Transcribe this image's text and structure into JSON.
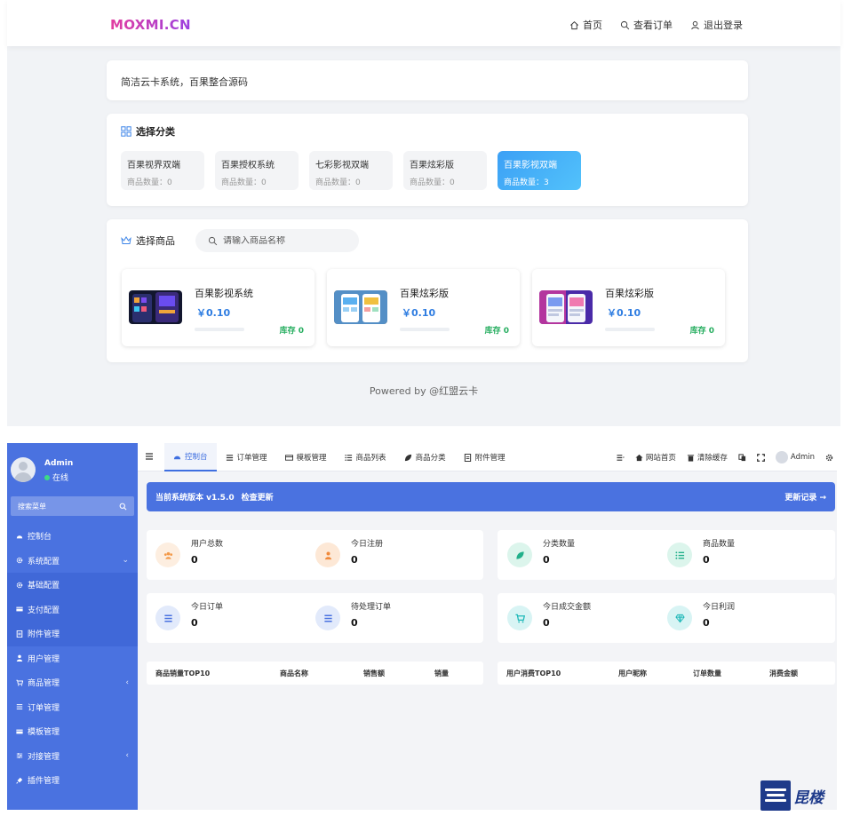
{
  "shop": {
    "logo": "MOXMI.CN",
    "nav": [
      {
        "label": "首页",
        "icon": "home-icon"
      },
      {
        "label": "查看订单",
        "icon": "search-icon"
      },
      {
        "label": "退出登录",
        "icon": "user-icon"
      }
    ],
    "notice": "简洁云卡系统，百果整合源码",
    "categories_title": "选择分类",
    "categories": [
      {
        "name": "百果视界双端",
        "count": "商品数量：0"
      },
      {
        "name": "百果授权系统",
        "count": "商品数量：0"
      },
      {
        "name": "七彩影视双端",
        "count": "商品数量：0"
      },
      {
        "name": "百果炫彩版",
        "count": "商品数量：0"
      },
      {
        "name": "百果影视双端",
        "count": "商品数量：3",
        "active": true
      }
    ],
    "goods_title": "选择商品",
    "search_placeholder": "请输入商品名称",
    "goods": [
      {
        "name": "百果影视系统",
        "price": "￥0.10",
        "stock": "库存 0"
      },
      {
        "name": "百果炫彩版",
        "price": "￥0.10",
        "stock": "库存 0"
      },
      {
        "name": "百果炫彩版",
        "price": "￥0.10",
        "stock": "库存 0"
      }
    ],
    "powered": "Powered by @红盟云卡"
  },
  "admin": {
    "user": {
      "name": "Admin",
      "status": "在线"
    },
    "search_label": "搜索菜单",
    "menu": [
      {
        "label": "控制台",
        "icon": "dashboard-icon"
      },
      {
        "label": "系统配置",
        "icon": "gear-icon",
        "arrow": "⌄"
      },
      {
        "label": "基础配置",
        "icon": "gear-icon",
        "sub": true
      },
      {
        "label": "支付配置",
        "icon": "card-icon",
        "sub": true
      },
      {
        "label": "附件管理",
        "icon": "file-icon",
        "sub": true
      },
      {
        "label": "用户管理",
        "icon": "user-icon"
      },
      {
        "label": "商品管理",
        "icon": "cart-icon",
        "arrow": "‹"
      },
      {
        "label": "订单管理",
        "icon": "list-icon"
      },
      {
        "label": "模板管理",
        "icon": "card-icon"
      },
      {
        "label": "对接管理",
        "icon": "sliders-icon",
        "arrow": "‹"
      },
      {
        "label": "插件管理",
        "icon": "plug-icon"
      }
    ],
    "tabs": [
      {
        "label": "控制台",
        "icon": "dashboard-icon",
        "active": true
      },
      {
        "label": "订单管理",
        "icon": "list-icon"
      },
      {
        "label": "模板管理",
        "icon": "card-icon"
      },
      {
        "label": "商品列表",
        "icon": "list-icon"
      },
      {
        "label": "商品分类",
        "icon": "leaf-icon"
      },
      {
        "label": "附件管理",
        "icon": "file-icon"
      }
    ],
    "tools": {
      "site_home": "网站首页",
      "clear_cache": "清除缓存",
      "username": "Admin"
    },
    "banner": {
      "version": "当前系统版本 v1.5.0",
      "check": "检查更新",
      "changelog": "更新记录 →"
    },
    "stats": [
      {
        "label": "用户总数",
        "value": "0",
        "icon": "users-icon",
        "color": "#f39a4a",
        "bg": "#fdeee0"
      },
      {
        "label": "今日注册",
        "value": "0",
        "icon": "user-icon",
        "color": "#f08a3c",
        "bg": "#fde8d6"
      },
      {
        "label": "分类数量",
        "value": "0",
        "icon": "leaf-icon",
        "color": "#22b08a",
        "bg": "#dcf5ec"
      },
      {
        "label": "商品数量",
        "value": "0",
        "icon": "list-icon",
        "color": "#22b08a",
        "bg": "#dcf5ec"
      },
      {
        "label": "今日订单",
        "value": "0",
        "icon": "list-icon",
        "color": "#4a72e0",
        "bg": "#e2eafb"
      },
      {
        "label": "待处理订单",
        "value": "0",
        "icon": "list-icon",
        "color": "#4a72e0",
        "bg": "#e2eafb"
      },
      {
        "label": "今日成交金额",
        "value": "0",
        "icon": "cart-icon",
        "color": "#1db8b8",
        "bg": "#d8f4f4"
      },
      {
        "label": "今日利润",
        "value": "0",
        "icon": "diamond-icon",
        "color": "#1db8b8",
        "bg": "#d8f4f4"
      }
    ],
    "table_left": [
      "商品销量TOP10",
      "商品名称",
      "销售额",
      "销量"
    ],
    "table_right": [
      "用户消费TOP10",
      "用户昵称",
      "订单数量",
      "消费金额"
    ]
  },
  "watermark": "昆楼"
}
